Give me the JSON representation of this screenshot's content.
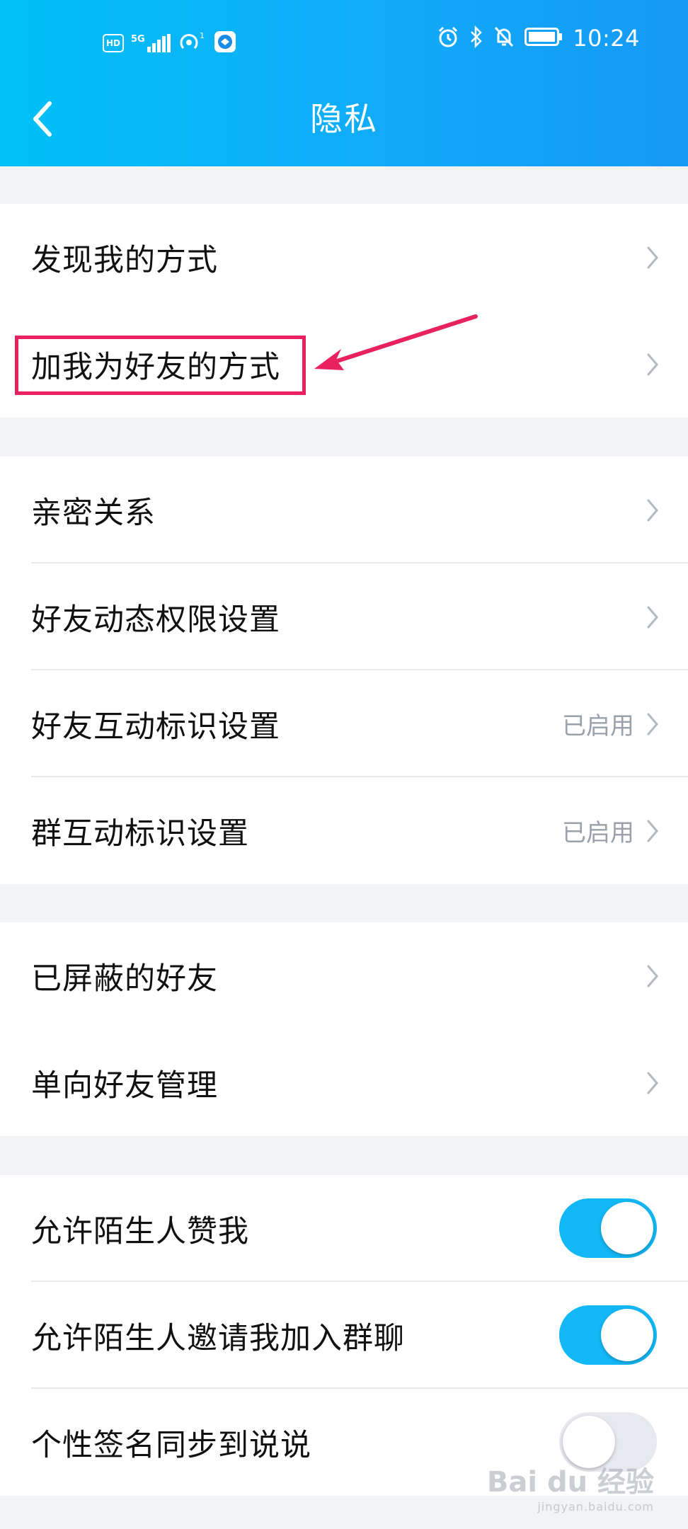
{
  "status_bar": {
    "hd_badge": "HD",
    "network": "5G",
    "time": "10:24"
  },
  "nav": {
    "title": "隐私"
  },
  "groups": {
    "discover": {
      "items": [
        {
          "label": "发现我的方式"
        },
        {
          "label": "加我为好友的方式"
        }
      ]
    },
    "friends": {
      "items": [
        {
          "label": "亲密关系",
          "value": ""
        },
        {
          "label": "好友动态权限设置",
          "value": ""
        },
        {
          "label": "好友互动标识设置",
          "value": "已启用"
        },
        {
          "label": "群互动标识设置",
          "value": "已启用"
        }
      ]
    },
    "blocked": {
      "items": [
        {
          "label": "已屏蔽的好友"
        },
        {
          "label": "单向好友管理"
        }
      ]
    },
    "toggles": {
      "items": [
        {
          "label": "允许陌生人赞我",
          "enabled": true
        },
        {
          "label": "允许陌生人邀请我加入群聊",
          "enabled": true
        },
        {
          "label": "个性签名同步到说说",
          "enabled": false
        }
      ]
    }
  },
  "watermark": {
    "brand": "Bai du 经验",
    "site": "jingyan.baidu.com"
  },
  "colors": {
    "accent": "#12b7f5",
    "annotation": "#e8215f",
    "toggle_off": "#e7e9ef"
  }
}
